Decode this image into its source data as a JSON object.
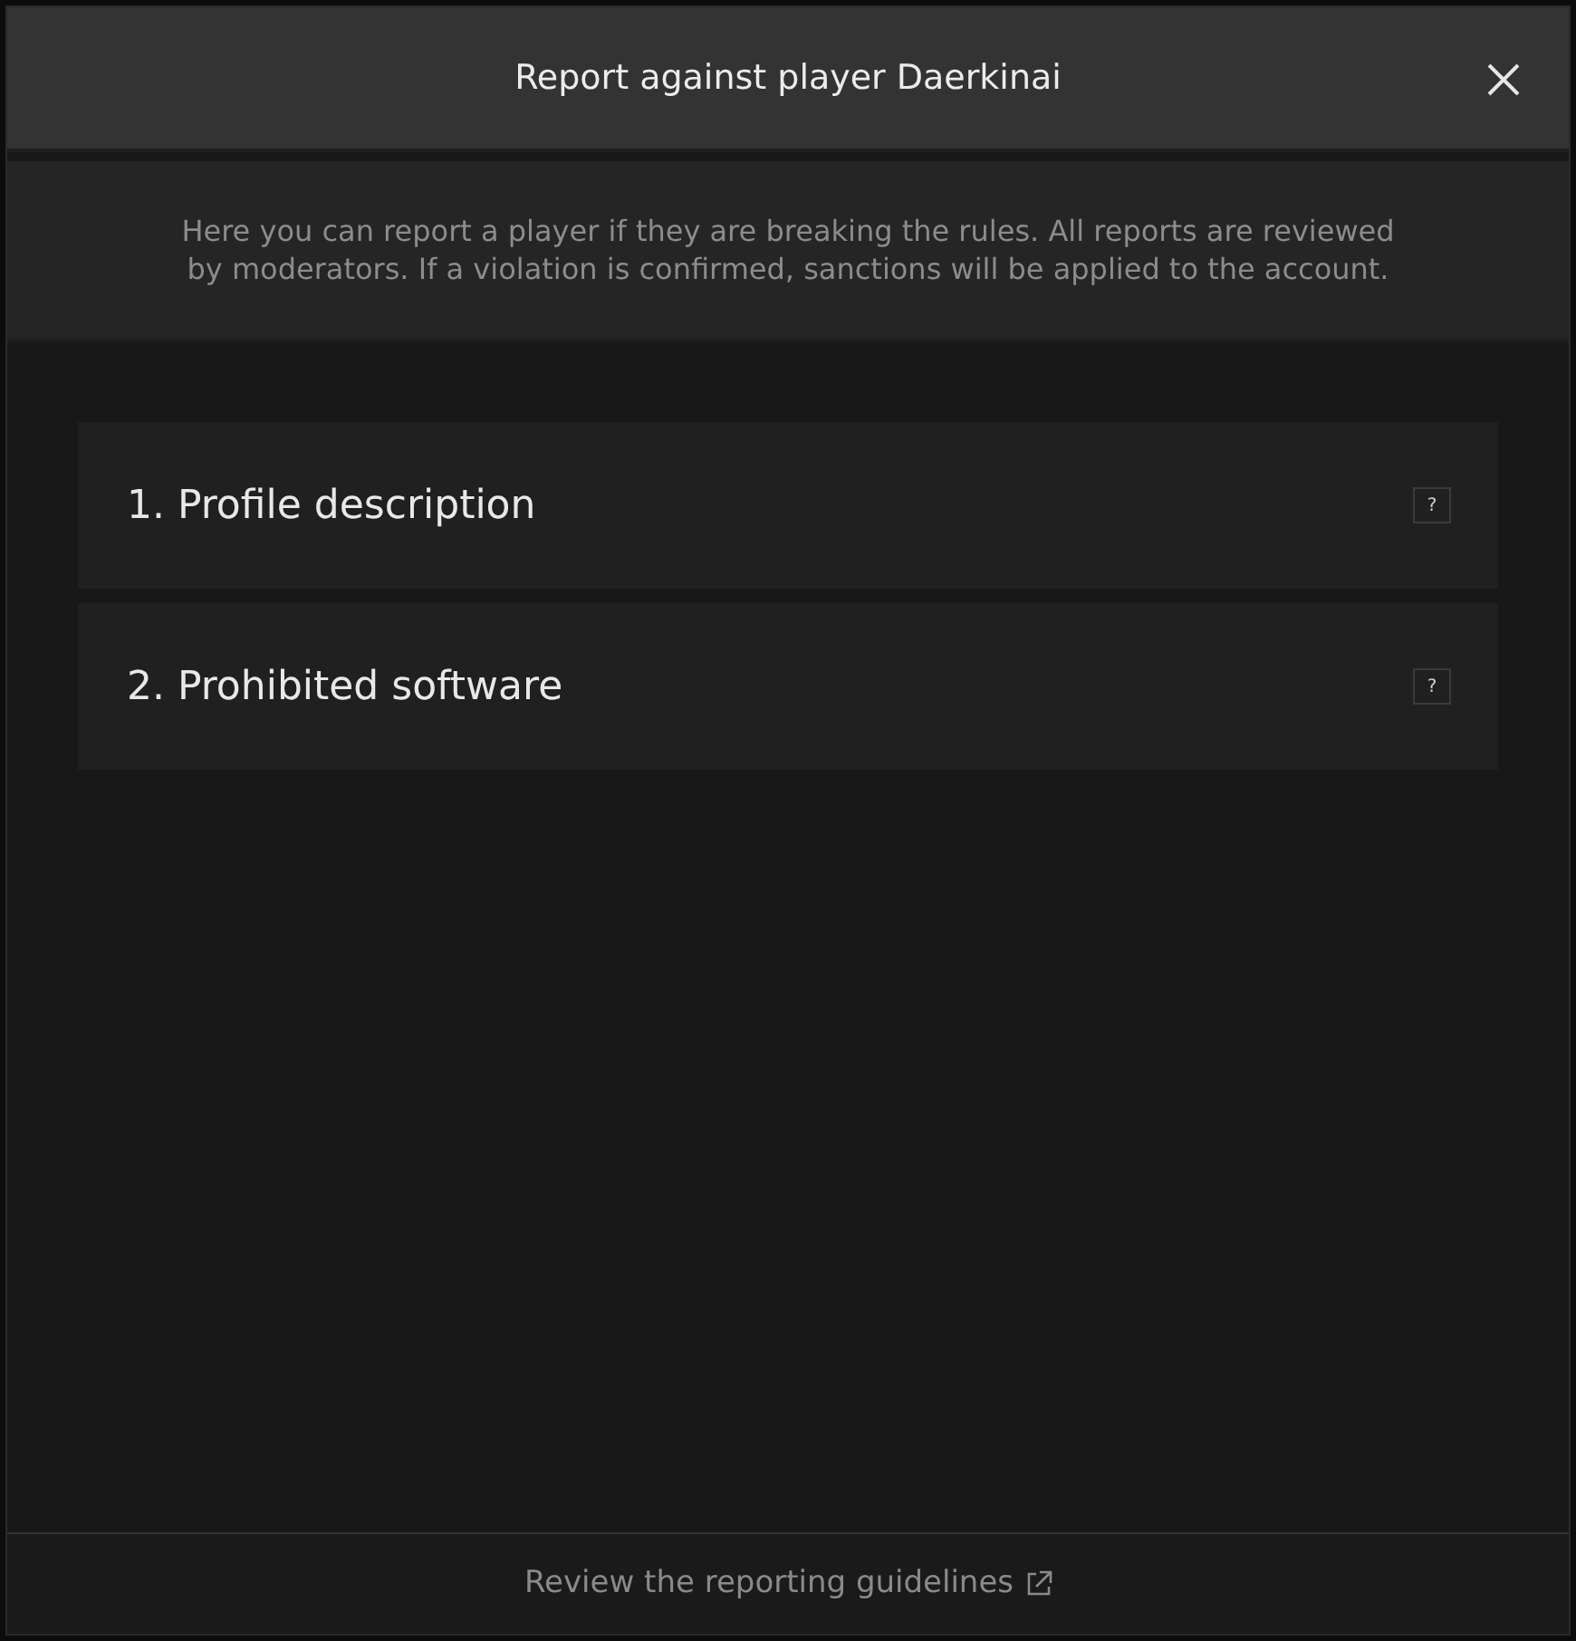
{
  "dialog": {
    "title": "Report against player Daerkinai",
    "description": "Here you can report a player if they are breaking the rules. All reports are reviewed by moderators. If a violation is confirmed, sanctions will be applied to the account.",
    "categories": [
      {
        "label": "1. Profile description",
        "help": "?"
      },
      {
        "label": "2. Prohibited software",
        "help": "?"
      }
    ],
    "footer_link": "Review the reporting guidelines"
  }
}
